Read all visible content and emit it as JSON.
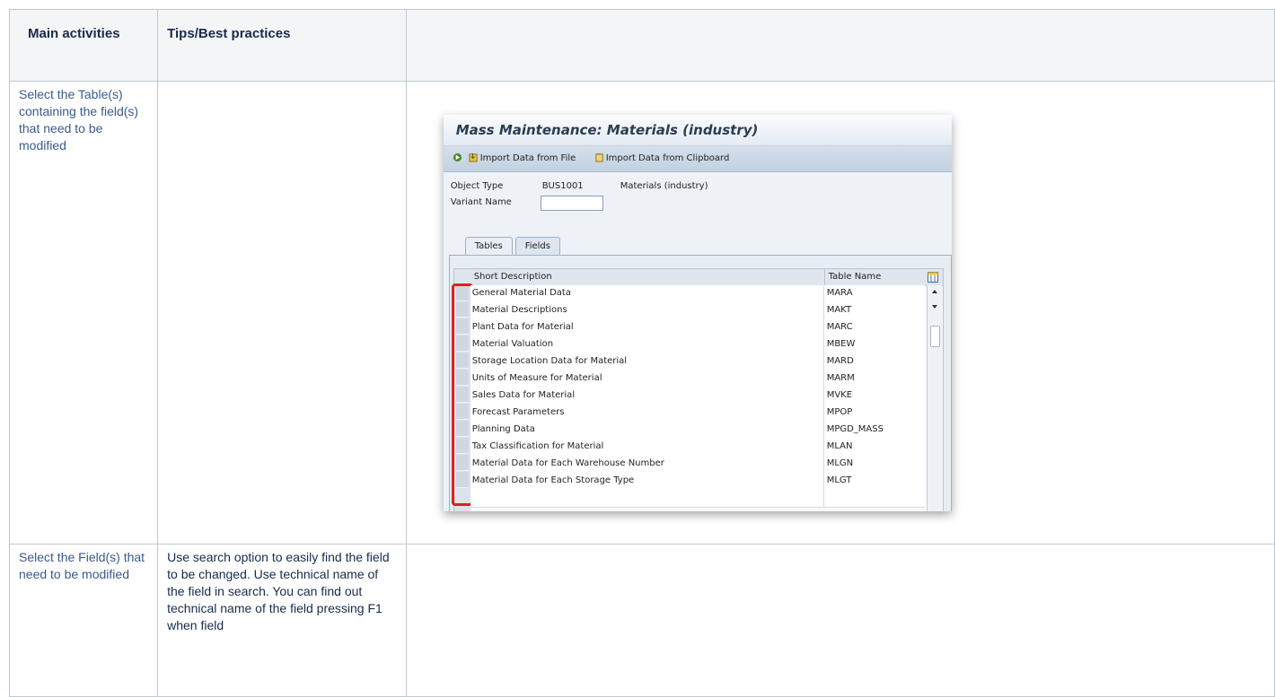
{
  "header": {
    "col1": "Main activities",
    "col2": "Tips/Best practices",
    "col3": ""
  },
  "rows": [
    {
      "activity": "Select the Table(s) containing the field(s) that need to be modified",
      "tips": ""
    },
    {
      "activity": "Select the Field(s) that need to be modified",
      "tips": "Use search option to easily find the field to be changed. Use technical name of the field in search. You can find out technical name of the field pressing F1 when field"
    }
  ],
  "sap": {
    "title": "Mass Maintenance: Materials (industry)",
    "toolbar": {
      "import_file": "Import Data from File",
      "import_clipboard": "Import Data from Clipboard"
    },
    "object_type_label": "Object Type",
    "object_type_value": "BUS1001",
    "object_type_desc": "Materials (industry)",
    "variant_label": "Variant Name",
    "variant_value": "",
    "tabs": [
      "Tables",
      "Fields"
    ],
    "grid": {
      "col_desc": "Short Description",
      "col_name": "Table Name",
      "rows": [
        {
          "desc": "General Material Data",
          "name": "MARA"
        },
        {
          "desc": "Material Descriptions",
          "name": "MAKT"
        },
        {
          "desc": "Plant Data for Material",
          "name": "MARC"
        },
        {
          "desc": "Material Valuation",
          "name": "MBEW"
        },
        {
          "desc": "Storage Location Data for Material",
          "name": "MARD"
        },
        {
          "desc": "Units of Measure for Material",
          "name": "MARM"
        },
        {
          "desc": "Sales Data for Material",
          "name": "MVKE"
        },
        {
          "desc": "Forecast Parameters",
          "name": "MPOP"
        },
        {
          "desc": "Planning Data",
          "name": "MPGD_MASS"
        },
        {
          "desc": "Tax Classification for Material",
          "name": "MLAN"
        },
        {
          "desc": "Material Data for Each Warehouse Number",
          "name": "MLGN"
        },
        {
          "desc": "Material Data for Each Storage Type",
          "name": "MLGT"
        }
      ]
    }
  }
}
